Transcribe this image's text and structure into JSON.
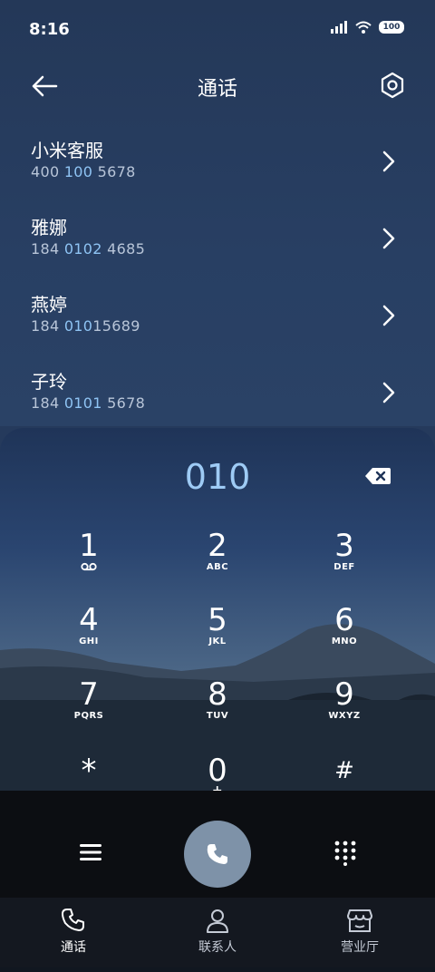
{
  "status_bar": {
    "time": "8:16",
    "battery": "100"
  },
  "header": {
    "title": "通话"
  },
  "recent_calls": [
    {
      "name": "小米客服",
      "number_prefix": "400 ",
      "number_match": "100",
      "number_suffix": " 5678"
    },
    {
      "name": "雅娜",
      "number_prefix": "184 ",
      "number_match": "0102",
      "number_suffix": " 4685"
    },
    {
      "name": "燕婷",
      "number_prefix": "184 ",
      "number_match": "010",
      "number_suffix": "15689"
    },
    {
      "name": "子玲",
      "number_prefix": "184 ",
      "number_match": "0101",
      "number_suffix": " 5678"
    }
  ],
  "dialer": {
    "input_value": "010",
    "keys": [
      {
        "digit": "1",
        "letters": ""
      },
      {
        "digit": "2",
        "letters": "ABC"
      },
      {
        "digit": "3",
        "letters": "DEF"
      },
      {
        "digit": "4",
        "letters": "GHI"
      },
      {
        "digit": "5",
        "letters": "JKL"
      },
      {
        "digit": "6",
        "letters": "MNO"
      },
      {
        "digit": "7",
        "letters": "PQRS"
      },
      {
        "digit": "8",
        "letters": "TUV"
      },
      {
        "digit": "9",
        "letters": "WXYZ"
      },
      {
        "digit": "*",
        "letters": ","
      },
      {
        "digit": "0",
        "letters": "+"
      },
      {
        "digit": "#",
        "letters": ""
      }
    ]
  },
  "bottom_nav": [
    {
      "label": "通话",
      "icon": "phone-icon"
    },
    {
      "label": "联系人",
      "icon": "person-icon"
    },
    {
      "label": "营业厅",
      "icon": "store-icon"
    }
  ],
  "colors": {
    "highlight": "#8fc4f4",
    "call_button": "#7e92a8"
  }
}
